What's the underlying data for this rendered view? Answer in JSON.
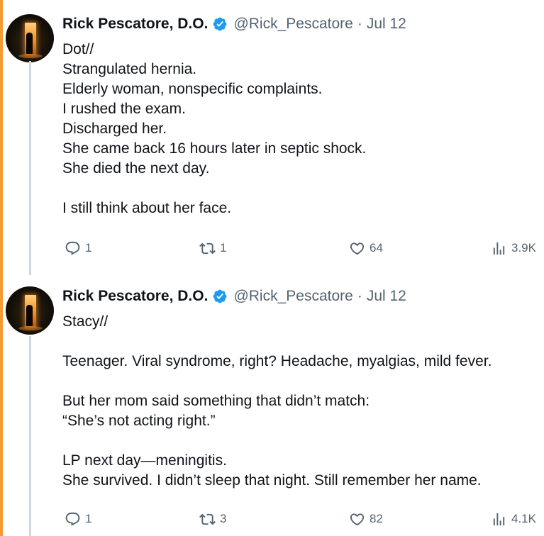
{
  "colors": {
    "accent_bar": "#f39c33",
    "verified_badge": "#1d9bf0",
    "secondary_text": "#536471",
    "thread_line": "#cfd9de"
  },
  "tweets": [
    {
      "author": {
        "name": "Rick Pescatore, D.O.",
        "handle": "@Rick_Pescatore",
        "verified_icon": "verified-badge-icon"
      },
      "separator": "·",
      "date": "Jul 12",
      "lines": [
        "Dot//",
        "Strangulated hernia.",
        "Elderly woman, nonspecific complaints.",
        "I rushed the exam.",
        "Discharged her.",
        "She came back 16 hours later in septic shock.",
        "She died the next day.",
        "",
        "I still think about her face."
      ],
      "stats": {
        "replies": "1",
        "retweets": "1",
        "likes": "64",
        "views": "3.9K"
      }
    },
    {
      "author": {
        "name": "Rick Pescatore, D.O.",
        "handle": "@Rick_Pescatore",
        "verified_icon": "verified-badge-icon"
      },
      "separator": "·",
      "date": "Jul 12",
      "lines": [
        "Stacy//",
        "",
        "Teenager. Viral syndrome, right? Headache, myalgias, mild fever.",
        "",
        "But her mom said something that didn’t match:",
        "“She’s not acting right.”",
        "",
        "LP next day—meningitis.",
        "She survived. I didn’t sleep that night. Still remember her name."
      ],
      "stats": {
        "replies": "1",
        "retweets": "3",
        "likes": "82",
        "views": "4.1K"
      }
    }
  ]
}
